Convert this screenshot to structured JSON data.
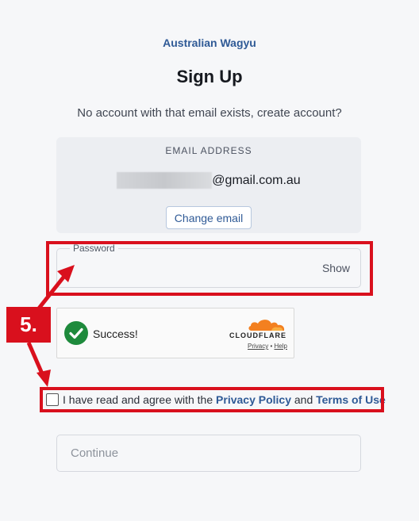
{
  "brand": "Australian Wagyu",
  "title": "Sign Up",
  "subtitle": "No account with that email exists, create account?",
  "email_card": {
    "label": "EMAIL ADDRESS",
    "domain_suffix": "@gmail.com.au",
    "change_button": "Change email"
  },
  "password": {
    "label": "Password",
    "value": "",
    "show_label": "Show"
  },
  "captcha": {
    "status": "Success!",
    "brand": "CLOUDFLARE",
    "privacy_link": "Privacy",
    "separator": "•",
    "help_link": "Help"
  },
  "agreement": {
    "checked": false,
    "prefix": "I have read and agree with the",
    "privacy_link": "Privacy Policy",
    "conjunction": "and",
    "terms_link": "Terms of Use"
  },
  "continue_button": "Continue",
  "annotation": {
    "step_label": "5.",
    "color": "#d9101d"
  },
  "colors": {
    "brand": "#2f5a96",
    "success": "#1e8a3c",
    "cloudflare_orange": "#f38020"
  }
}
